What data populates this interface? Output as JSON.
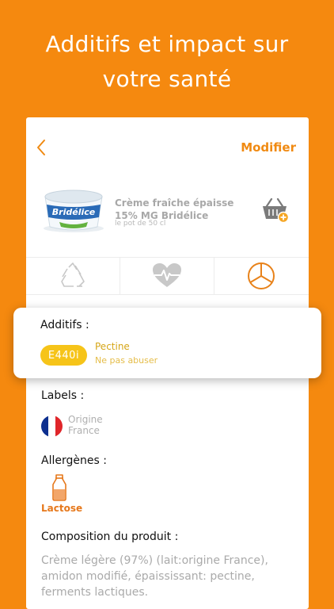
{
  "headline": {
    "line1": "Additifs et impact sur",
    "line2": "votre santé"
  },
  "header": {
    "modify_label": "Modifier"
  },
  "product": {
    "name": "Crème fraîche épaisse 15% MG Bridélice",
    "quantity": "le pot de 50 cl",
    "brand_logo_text": "Bridélice"
  },
  "tabs": [
    {
      "icon": "recycle-icon"
    },
    {
      "icon": "heart-pulse-icon"
    },
    {
      "icon": "mercedes-emblem-icon"
    }
  ],
  "additives": {
    "title": "Additifs :",
    "code": "E440i",
    "name": "Pectine",
    "note": "Ne pas abuser"
  },
  "labels": {
    "title": "Labels :",
    "origin_line1": "Origine",
    "origin_line2": "France"
  },
  "allergens": {
    "title": "Allergènes :",
    "item": "Lactose"
  },
  "composition": {
    "title": "Composition du produit :",
    "text": "Crème légère (97%) (lait:origine France), amidon modifié, épaississant: pectine, ferments lactiques."
  },
  "colors": {
    "brand_orange": "#F5890F",
    "badge_yellow": "#F6C419",
    "flag_blue": "#0D2F8F",
    "flag_red": "#E0262A"
  }
}
